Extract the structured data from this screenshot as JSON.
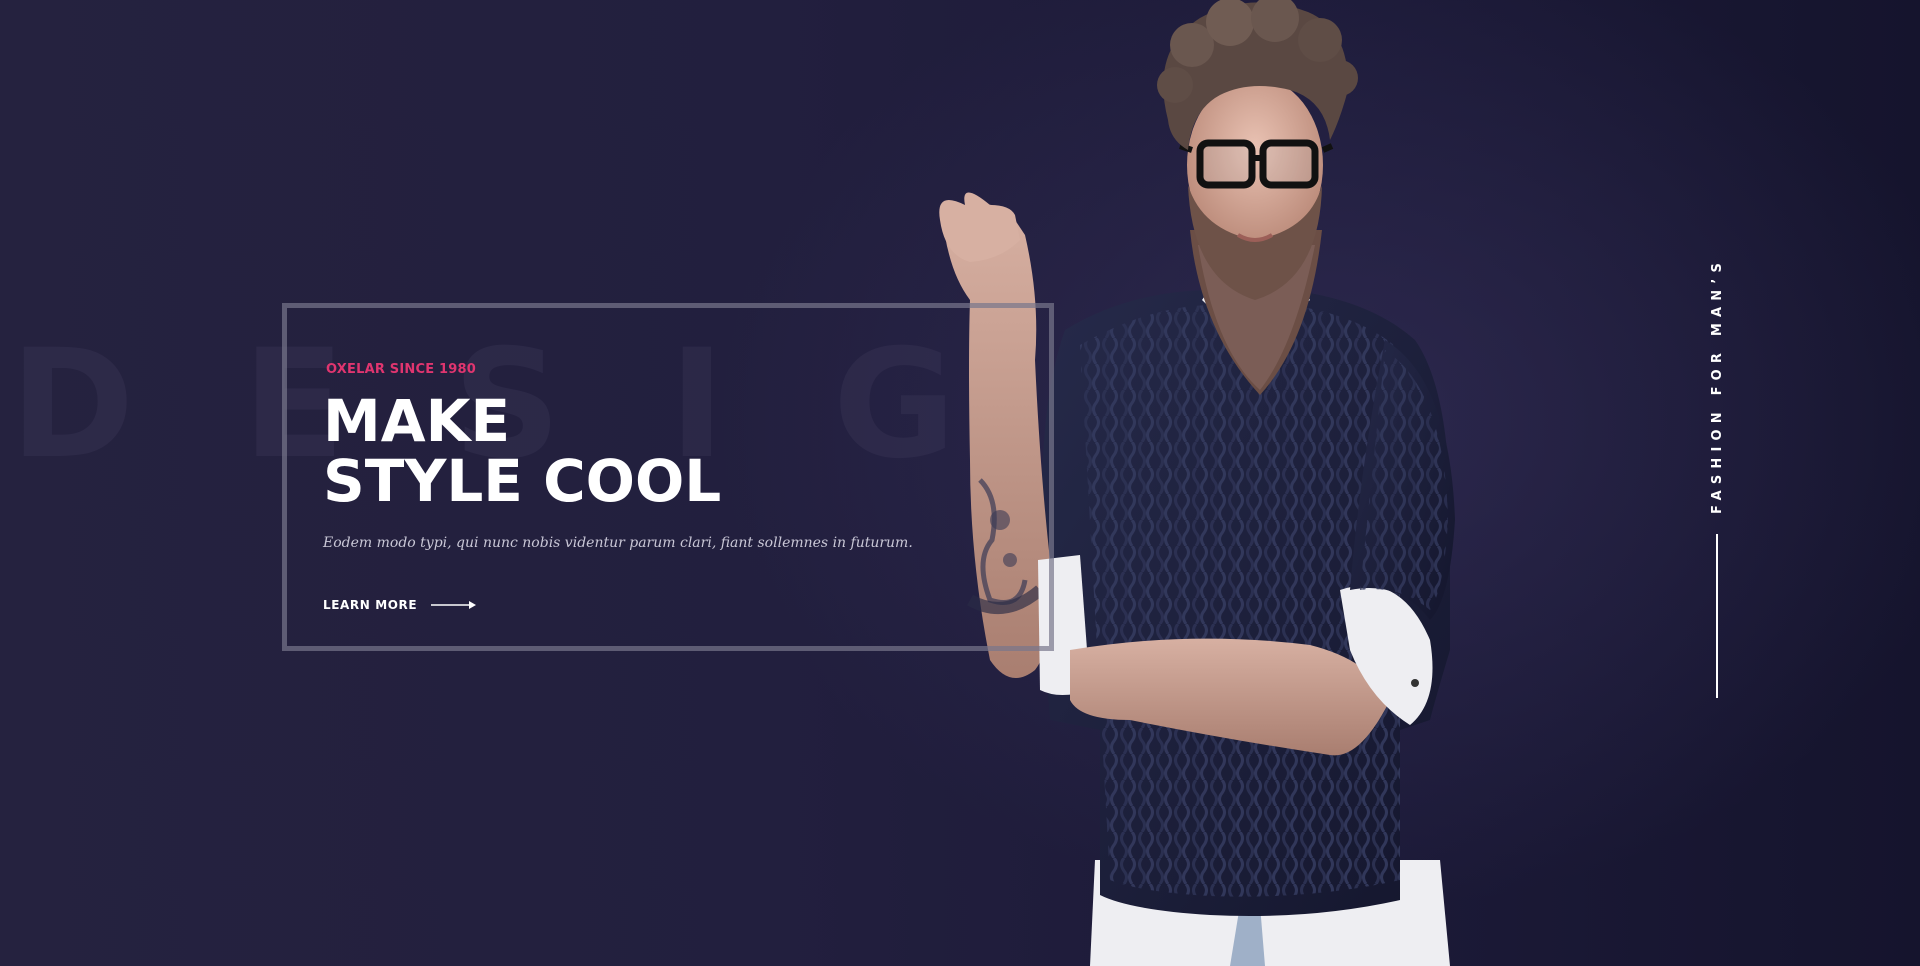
{
  "hero": {
    "background_word": "DESIGN",
    "tagline": "OXELAR SINCE 1980",
    "headline_line1": "MAKE",
    "headline_line2": "STYLE COOL",
    "description": "Eodem modo typi, qui nunc nobis videntur parum clari, fiant sollemnes in futurum.",
    "cta_label": "LEARN MORE",
    "cta_icon": "arrow-right-icon",
    "side_caption": "FASHION FOR MAN’S"
  },
  "colors": {
    "background": "#221f3e",
    "accent": "#e0356f",
    "headline": "#ffffff",
    "frame": "#78768c",
    "sweater": "#1d1f3b",
    "shirt": "#eeeef2"
  }
}
